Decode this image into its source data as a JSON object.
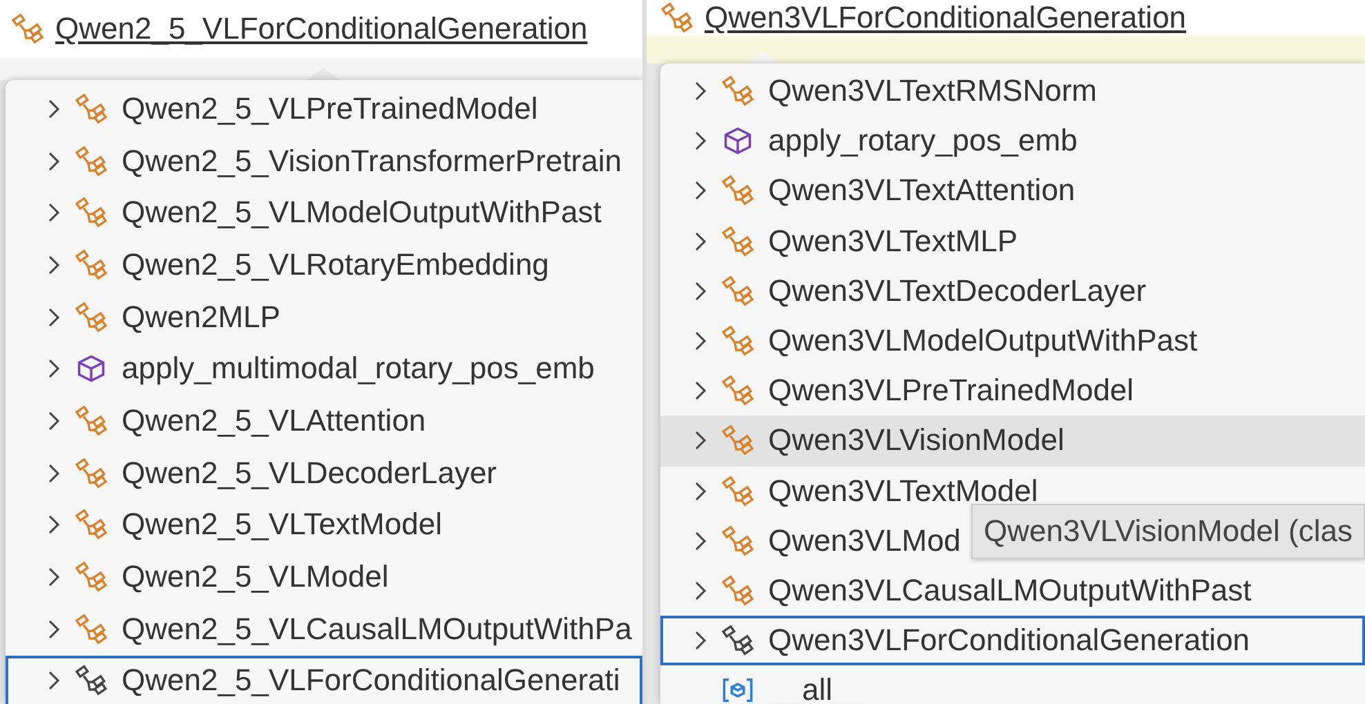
{
  "panels": [
    {
      "title": "Qwen2_5_VLForConditionalGeneration",
      "items": [
        {
          "label": "Qwen2_5_VLPreTrainedModel",
          "kind": "class",
          "selected": false,
          "hovered": false
        },
        {
          "label": "Qwen2_5_VisionTransformerPretrain",
          "kind": "class",
          "selected": false,
          "hovered": false
        },
        {
          "label": "Qwen2_5_VLModelOutputWithPast",
          "kind": "class",
          "selected": false,
          "hovered": false
        },
        {
          "label": "Qwen2_5_VLRotaryEmbedding",
          "kind": "class",
          "selected": false,
          "hovered": false
        },
        {
          "label": "Qwen2MLP",
          "kind": "class",
          "selected": false,
          "hovered": false
        },
        {
          "label": "apply_multimodal_rotary_pos_emb",
          "kind": "function",
          "selected": false,
          "hovered": false
        },
        {
          "label": "Qwen2_5_VLAttention",
          "kind": "class",
          "selected": false,
          "hovered": false
        },
        {
          "label": "Qwen2_5_VLDecoderLayer",
          "kind": "class",
          "selected": false,
          "hovered": false
        },
        {
          "label": "Qwen2_5_VLTextModel",
          "kind": "class",
          "selected": false,
          "hovered": false
        },
        {
          "label": "Qwen2_5_VLModel",
          "kind": "class",
          "selected": false,
          "hovered": false
        },
        {
          "label": "Qwen2_5_VLCausalLMOutputWithPa",
          "kind": "class",
          "selected": false,
          "hovered": false
        },
        {
          "label": "Qwen2_5_VLForConditionalGenerati",
          "kind": "class",
          "selected": true,
          "hovered": false
        }
      ]
    },
    {
      "title": "Qwen3VLForConditionalGeneration",
      "items": [
        {
          "label": "Qwen3VLTextRMSNorm",
          "kind": "class",
          "selected": false,
          "hovered": false
        },
        {
          "label": "apply_rotary_pos_emb",
          "kind": "function",
          "selected": false,
          "hovered": false
        },
        {
          "label": "Qwen3VLTextAttention",
          "kind": "class",
          "selected": false,
          "hovered": false
        },
        {
          "label": "Qwen3VLTextMLP",
          "kind": "class",
          "selected": false,
          "hovered": false
        },
        {
          "label": "Qwen3VLTextDecoderLayer",
          "kind": "class",
          "selected": false,
          "hovered": false
        },
        {
          "label": "Qwen3VLModelOutputWithPast",
          "kind": "class",
          "selected": false,
          "hovered": false
        },
        {
          "label": "Qwen3VLPreTrainedModel",
          "kind": "class",
          "selected": false,
          "hovered": false
        },
        {
          "label": "Qwen3VLVisionModel",
          "kind": "class",
          "selected": false,
          "hovered": true
        },
        {
          "label": "Qwen3VLTextModel",
          "kind": "class",
          "selected": false,
          "hovered": false
        },
        {
          "label": "Qwen3VLMod",
          "kind": "class",
          "selected": false,
          "hovered": false
        },
        {
          "label": "Qwen3VLCausalLMOutputWithPast",
          "kind": "class",
          "selected": false,
          "hovered": false
        },
        {
          "label": "Qwen3VLForConditionalGeneration",
          "kind": "class",
          "selected": true,
          "hovered": false
        },
        {
          "label": "__all__",
          "kind": "variable",
          "selected": false,
          "hovered": false
        }
      ],
      "tooltip": "Qwen3VLVisionModel (clas"
    }
  ]
}
